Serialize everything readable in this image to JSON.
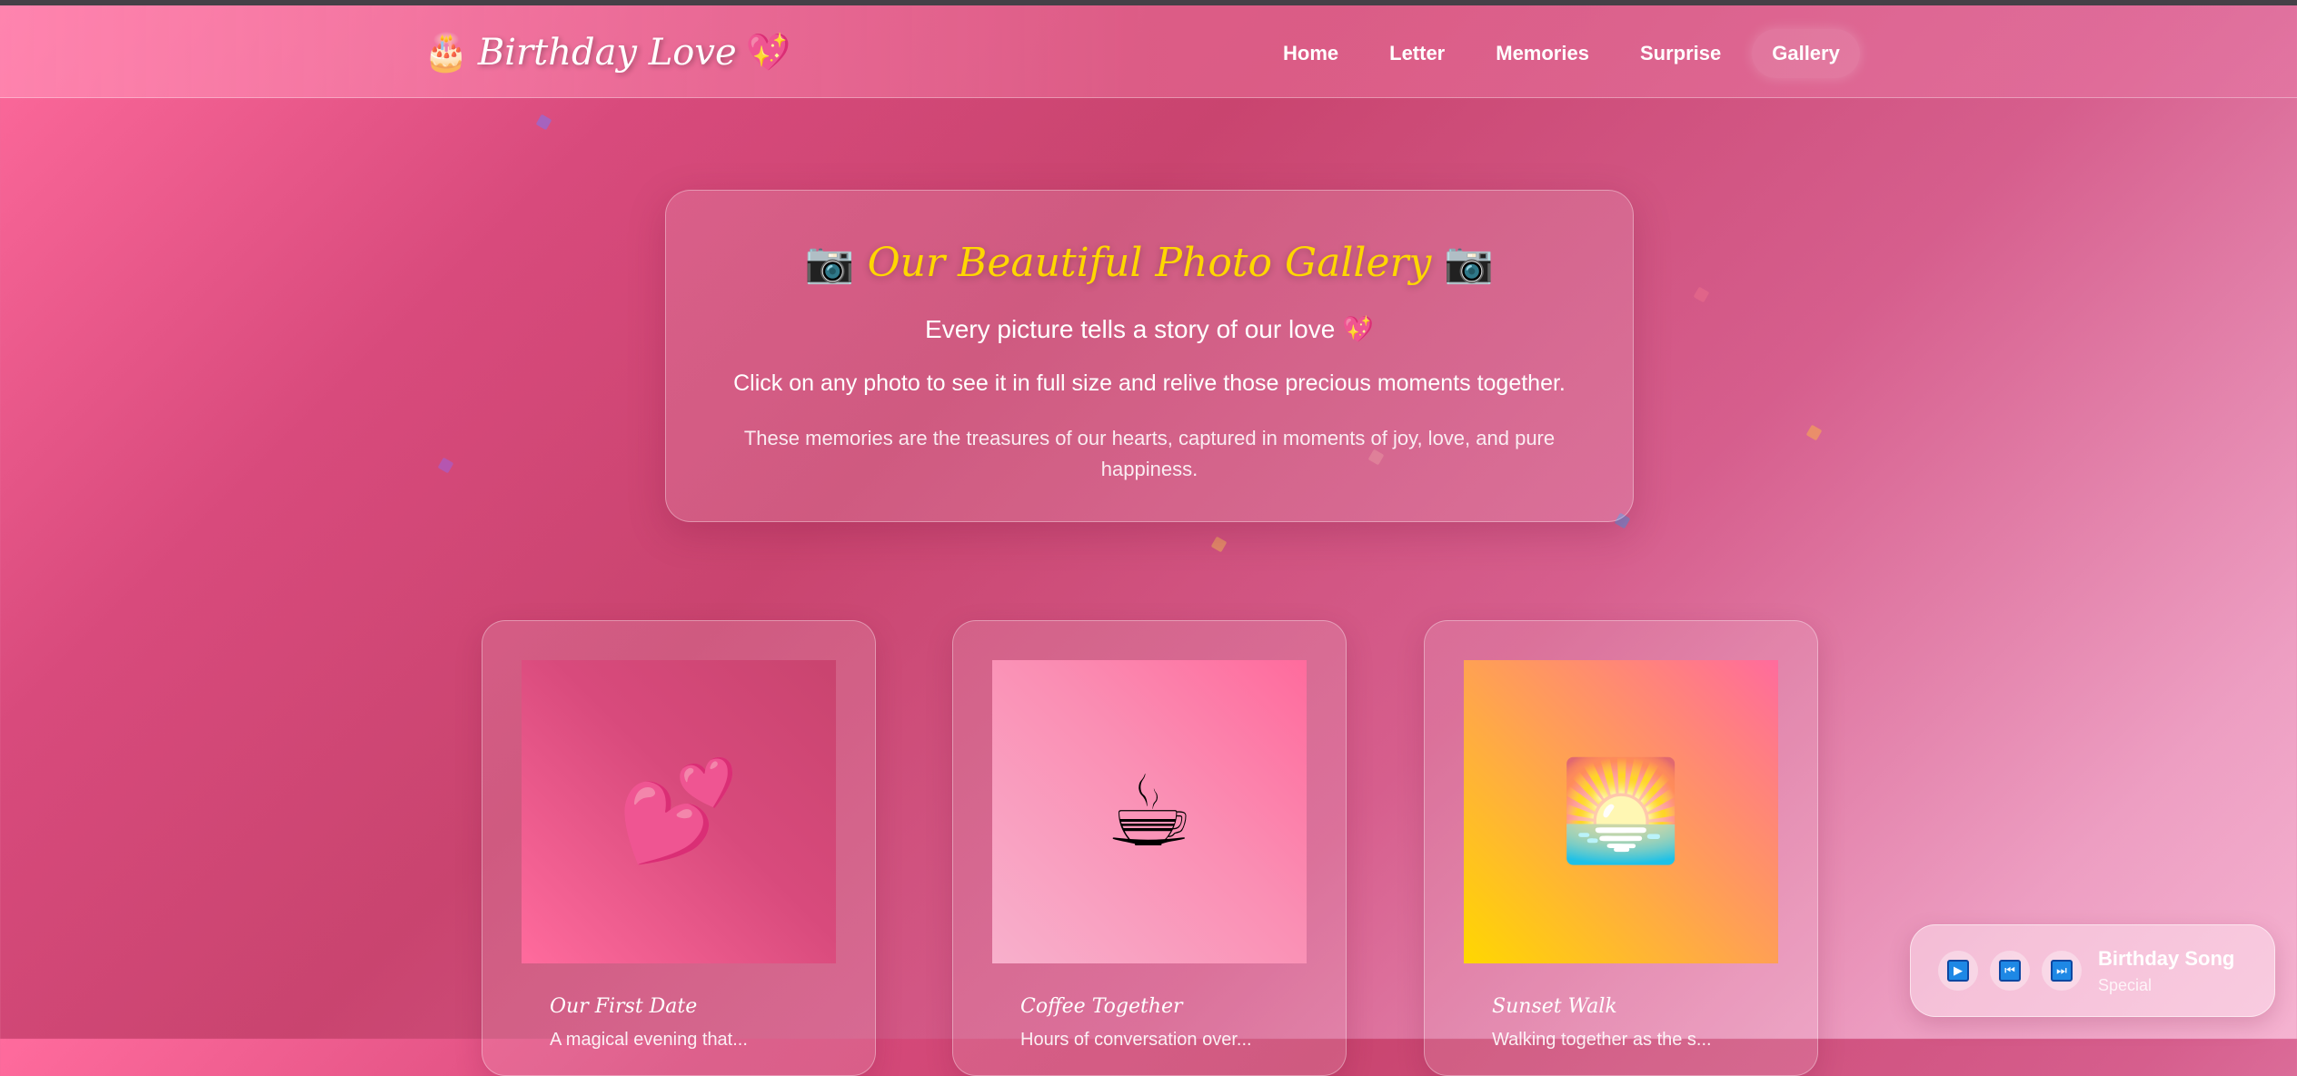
{
  "nav": {
    "brand": {
      "cake": "🎂",
      "text": "Birthday Love",
      "heart": "💖"
    },
    "links": [
      {
        "label": "Home"
      },
      {
        "label": "Letter"
      },
      {
        "label": "Memories"
      },
      {
        "label": "Surprise"
      },
      {
        "label": "Gallery",
        "active": true
      }
    ]
  },
  "hero": {
    "camera": "📷",
    "title": "Our Beautiful Photo Gallery",
    "subtitle": "Every picture tells a story of our love 💖",
    "desc": "Click on any photo to see it in full size and relive those precious moments together.",
    "note": "These memories are the treasures of our hearts, captured in moments of joy, love, and pure happiness."
  },
  "cards": [
    {
      "emoji": "💕",
      "title": "Our First Date",
      "desc": "A magical evening that..."
    },
    {
      "emoji": "☕",
      "title": "Coffee Together",
      "desc": "Hours of conversation over..."
    },
    {
      "emoji": "🌅",
      "title": "Sunset Walk",
      "desc": "Walking together as the s..."
    }
  ],
  "player": {
    "play": "▶",
    "prev": "⏮",
    "next": "⏭",
    "title": "Birthday Song",
    "subtitle": "Special"
  },
  "colors": {
    "accent_gold": "#ffd700",
    "player_button": "#1e88e5"
  }
}
